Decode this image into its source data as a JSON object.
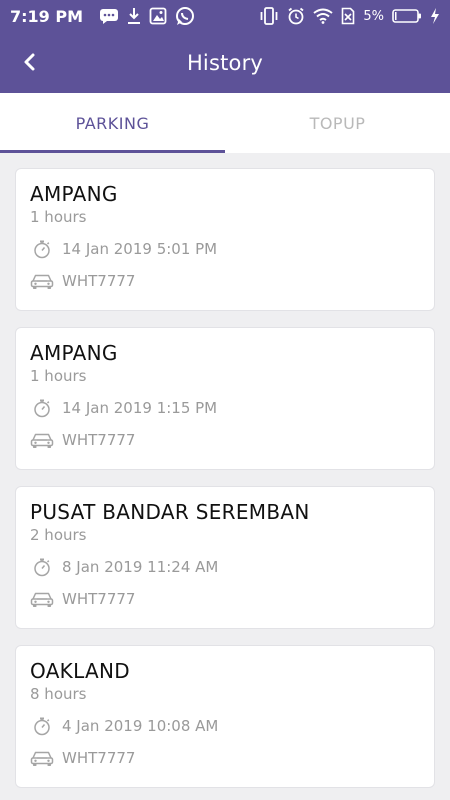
{
  "status_bar": {
    "time": "7:19 PM",
    "battery_percent": "5%",
    "icons_left": [
      "message-icon",
      "download-icon",
      "image-icon",
      "whatsapp-icon"
    ],
    "icons_right": [
      "vibrate-icon",
      "alarm-icon",
      "wifi-icon",
      "sim-off-icon",
      "battery-icon",
      "charging-icon"
    ]
  },
  "header": {
    "title": "History",
    "background": "#5d5298"
  },
  "tabs": [
    {
      "label": "PARKING",
      "active": true
    },
    {
      "label": "TOPUP",
      "active": false
    }
  ],
  "history": [
    {
      "place": "AMPANG",
      "duration": "1 hours",
      "datetime": "14 Jan 2019 5:01 PM",
      "plate": "WHT7777"
    },
    {
      "place": "AMPANG",
      "duration": "1 hours",
      "datetime": "14 Jan 2019 1:15 PM",
      "plate": "WHT7777"
    },
    {
      "place": "PUSAT BANDAR SEREMBAN",
      "duration": "2 hours",
      "datetime": "8 Jan 2019 11:24 AM",
      "plate": "WHT7777"
    },
    {
      "place": "OAKLAND",
      "duration": "8 hours",
      "datetime": "4 Jan 2019 10:08 AM",
      "plate": "WHT7777"
    }
  ],
  "colors": {
    "accent": "#5d5298",
    "muted_text": "#9a9a9a",
    "background": "#efeff1"
  }
}
